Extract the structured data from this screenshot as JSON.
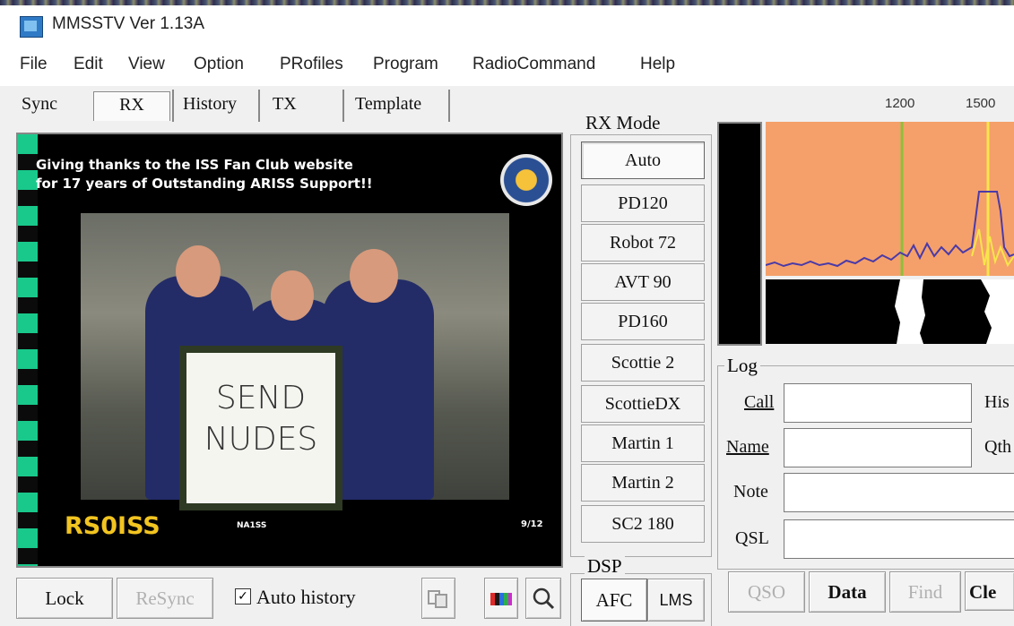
{
  "window": {
    "title": "MMSSTV Ver 1.13A"
  },
  "menu": [
    "File",
    "Edit",
    "View",
    "Option",
    "PRofiles",
    "Program",
    "RadioCommand",
    "Help"
  ],
  "tabs": [
    {
      "label": "Sync",
      "active": false
    },
    {
      "label": "RX",
      "active": true
    },
    {
      "label": "History",
      "active": false
    },
    {
      "label": "TX",
      "active": false
    },
    {
      "label": "Template",
      "active": false
    }
  ],
  "rx_image": {
    "caption_line1": "Giving thanks to the ISS Fan Club website",
    "caption_line2": "for 17 years of Outstanding ARISS Support!!",
    "sign_line1": "SEND",
    "sign_line2": "NUDES",
    "callsign": "RS0ISS",
    "small_id": "NA1SS",
    "small_date": "9/12"
  },
  "rx_controls": {
    "lock": "Lock",
    "resync": "ReSync",
    "auto_history": "Auto history",
    "auto_history_checked": true,
    "icons": [
      "copy-icon",
      "color-bars-icon",
      "magnifier-icon"
    ]
  },
  "rx_mode": {
    "legend": "RX Mode",
    "modes": [
      "Auto",
      "PD120",
      "Robot 72",
      "AVT 90",
      "PD160",
      "Scottie 2",
      "ScottieDX",
      "Martin 1",
      "Martin 2",
      "SC2 180"
    ],
    "selected": "Auto"
  },
  "dsp": {
    "legend": "DSP",
    "afc": "AFC",
    "lms": "LMS"
  },
  "spectrum": {
    "freq_labels": [
      "1200",
      "1500"
    ],
    "colors": {
      "background": "#f5a06a",
      "trace": "#4a3aa8",
      "marker_green": "#8fbf3a",
      "marker_yellow": "#f7e54a"
    }
  },
  "log": {
    "legend": "Log",
    "fields": [
      {
        "label": "Call",
        "value": "",
        "side_label": "His"
      },
      {
        "label": "Name",
        "value": "",
        "side_label": "Qth"
      },
      {
        "label": "Note",
        "value": ""
      },
      {
        "label": "QSL",
        "value": ""
      }
    ],
    "buttons": [
      {
        "label": "QSO",
        "enabled": false
      },
      {
        "label": "Data",
        "enabled": true
      },
      {
        "label": "Find",
        "enabled": false
      },
      {
        "label": "Cle",
        "enabled": true
      }
    ]
  }
}
